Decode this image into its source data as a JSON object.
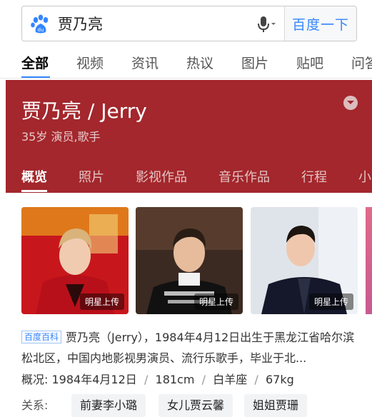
{
  "search": {
    "query": "贾乃亮",
    "button": "百度一下"
  },
  "nav": {
    "tabs": [
      "全部",
      "视频",
      "资讯",
      "热议",
      "图片",
      "贴吧",
      "问答"
    ]
  },
  "card": {
    "name": "贾乃亮 / Jerry",
    "meta": "35岁 演员,歌手",
    "tabs": [
      "概览",
      "照片",
      "影视作品",
      "音乐作品",
      "行程",
      "小"
    ]
  },
  "photos": [
    {
      "label": "明星上传"
    },
    {
      "label": "明星上传"
    },
    {
      "label": "明星上传"
    }
  ],
  "description": {
    "source_badge": "百度百科",
    "text": "贾乃亮（Jerry），1984年4月12日出生于黑龙江省哈尔滨松北区，中国内地影视男演员、流行乐歌手，毕业于北..."
  },
  "overview": {
    "label": "概况:",
    "birthday": "1984年4月12日",
    "height": "181cm",
    "zodiac": "白羊座",
    "weight": "67kg"
  },
  "relations": {
    "label": "关系:",
    "items": [
      "前妻李小璐",
      "女儿贾云馨",
      "姐姐贾珊"
    ]
  },
  "colors": {
    "card_red": "#a3272c",
    "link_blue": "#3385ff"
  }
}
